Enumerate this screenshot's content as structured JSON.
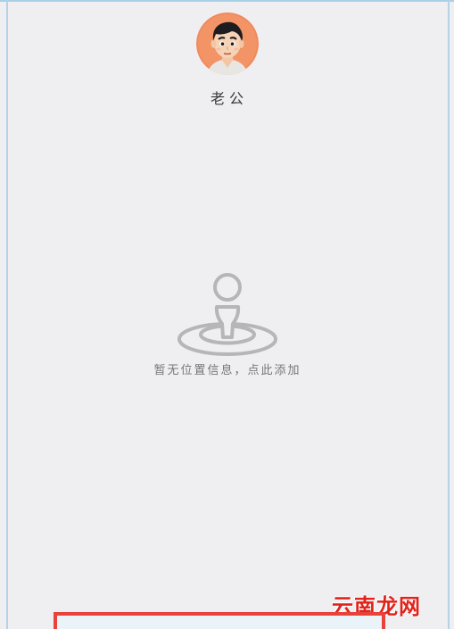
{
  "profile": {
    "name": "老公"
  },
  "empty_state": {
    "message": "暂无位置信息，点此添加"
  },
  "watermark": {
    "text_1": "云",
    "text_2": "南",
    "text_3": "龙",
    "text_4": "网"
  },
  "colors": {
    "background": "#efeef0",
    "highlight_border": "#e8423a",
    "watermark": "#e0231b"
  },
  "icons": {
    "location": "location-pin-icon",
    "avatar": "cartoon-man-avatar"
  }
}
